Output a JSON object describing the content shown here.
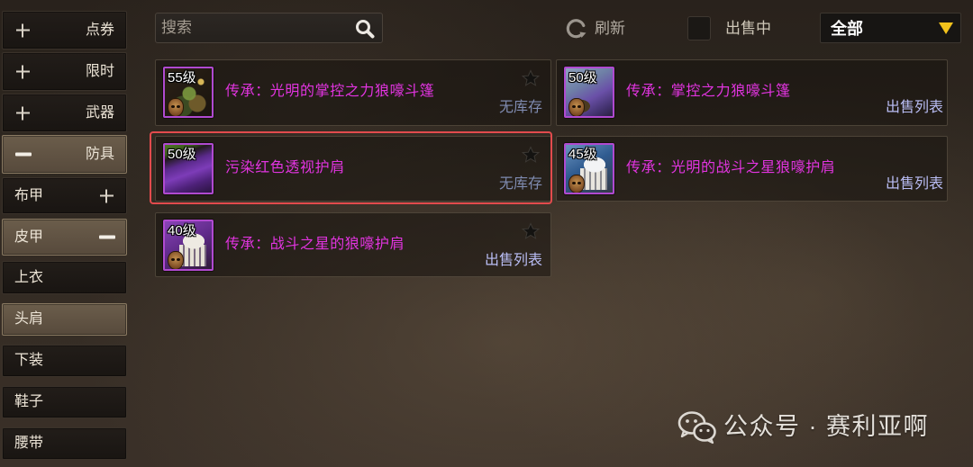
{
  "sidebar": {
    "items": [
      {
        "label": "点券",
        "toggle_icon": "plus-icon",
        "active": false
      },
      {
        "label": "限时",
        "toggle_icon": "plus-icon",
        "active": false
      },
      {
        "label": "武器",
        "toggle_icon": "plus-icon",
        "active": false
      },
      {
        "label": "防具",
        "toggle_icon": "minus-icon",
        "active": true
      },
      {
        "label": "布甲",
        "toggle_icon": "plus-icon",
        "active": false
      },
      {
        "label": "皮甲",
        "toggle_icon": "minus-icon",
        "active": true
      },
      {
        "label": "上衣",
        "active": false
      },
      {
        "label": "头肩",
        "active": true
      },
      {
        "label": "下装",
        "active": false
      },
      {
        "label": "鞋子",
        "active": false
      },
      {
        "label": "腰带",
        "active": false
      }
    ]
  },
  "toolbar": {
    "search": {
      "placeholder": "搜索",
      "value": "",
      "icon": "search-icon"
    },
    "refresh": {
      "label": "刷新",
      "icon": "refresh-icon"
    },
    "on_sale_filter": {
      "label": "出售中",
      "checked": false
    },
    "category_dropdown": {
      "selected": "全部",
      "icon": "triangle-down-icon"
    }
  },
  "listings": [
    {
      "level": "55级",
      "name": "传承：光明的掌控之力狼嚎斗篷",
      "status": "无库存",
      "favorite_icon": "star-icon",
      "badge_icon": "mask-badge-icon",
      "item_icon": "cloak-icon",
      "highlighted": false
    },
    {
      "level": "50级",
      "name": "传承：掌控之力狼嚎斗篷",
      "status": "出售列表",
      "badge_icon": "mask-badge-icon",
      "item_icon": "cloak-icon",
      "highlighted": false
    },
    {
      "level": "50级",
      "name": "污染红色透视护肩",
      "status": "无库存",
      "favorite_icon": "star-icon",
      "item_icon": "shoulder-icon",
      "highlighted": true
    },
    {
      "level": "45级",
      "name": "传承：光明的战斗之星狼嚎护肩",
      "status": "出售列表",
      "badge_icon": "mask-badge-icon",
      "item_icon": "shoulder-icon",
      "highlighted": false
    },
    {
      "level": "40级",
      "name": "传承：战斗之星的狼嚎护肩",
      "status": "出售列表",
      "favorite_icon": "star-icon",
      "badge_icon": "mask-badge-icon",
      "item_icon": "shoulder-icon",
      "highlighted": false
    }
  ],
  "watermark": {
    "icon": "wechat-icon",
    "text": "公众号 · 赛利亚啊"
  },
  "colors": {
    "sidebar_text": "#ece4d6",
    "item_name": "#e234e0",
    "status_no_stock": "#7f8bb0",
    "status_sale_list": "#b9bdf4",
    "dropdown_arrow": "#f2c21c",
    "selection_border": "#e24b4d",
    "rarity_frame": "#b04ad0"
  }
}
